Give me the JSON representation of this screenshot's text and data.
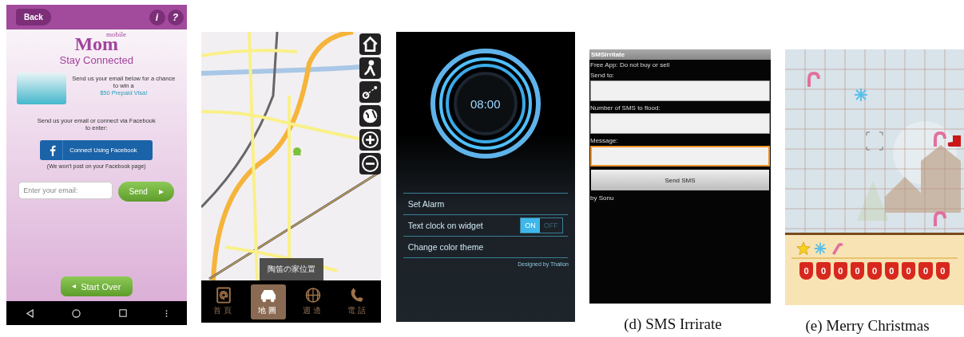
{
  "mobile_mom": {
    "back_button": "Back",
    "info_button": "i",
    "help_button": "?",
    "logo_small": "mobile",
    "logo": "Mom",
    "title": "Stay Connected",
    "promo_text": "Send us your email below for a chance to win a",
    "promo_link": "$50 Prepaid Visa!",
    "instructions": "Send us your email or connect via Facebook to enter:",
    "facebook_button": "Connect Using Facebook",
    "facebook_note": "(We won't post on your Facebook page)",
    "email_field": {
      "placeholder": "Enter your email:"
    },
    "send_button": "Send",
    "start_over_button": "Start Over"
  },
  "map_app": {
    "toast": "陶笛の家位置",
    "nav": [
      {
        "label": "首頁",
        "selected": false
      },
      {
        "label": "地圖",
        "selected": true
      },
      {
        "label": "週邊",
        "selected": false
      },
      {
        "label": "電話",
        "selected": false
      }
    ]
  },
  "alarm_clock": {
    "time": "08:00",
    "menu": [
      {
        "kind": "link",
        "label": "Set Alarm"
      },
      {
        "kind": "toggle",
        "label": "Text clock on widget",
        "on_label": "ON",
        "off_label": "OFF",
        "on": true
      },
      {
        "kind": "link",
        "label": "Change color theme"
      }
    ],
    "credit": "Designed by Thalion"
  },
  "sms_irritate": {
    "title": "SMSIrritate",
    "notice": "Free App: Do not buy or sell",
    "fields": [
      {
        "label": "Send to:",
        "focused": false
      },
      {
        "label": "Number of SMS to flood:",
        "focused": false
      },
      {
        "label": "Message:",
        "focused": true
      }
    ],
    "button": "Send SMS",
    "author": "by Sonu",
    "caption": "(d) SMS Irrirate"
  },
  "christmas_game": {
    "stockings": [
      {
        "count": "0"
      },
      {
        "count": "0"
      },
      {
        "count": "0"
      },
      {
        "count": "0"
      },
      {
        "count": "0"
      },
      {
        "count": "0"
      },
      {
        "count": "0"
      },
      {
        "count": "0"
      },
      {
        "count": "0"
      }
    ],
    "caption": "(e) Merry Christmas"
  }
}
